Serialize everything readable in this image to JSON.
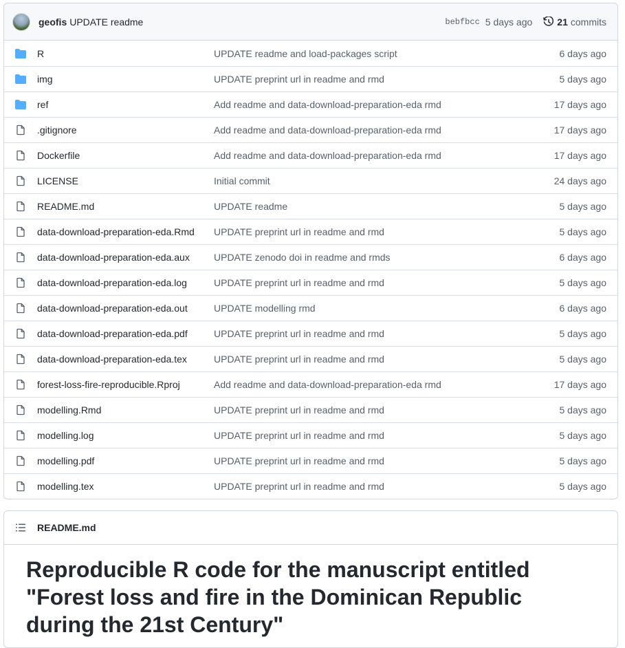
{
  "commit": {
    "author": "geofis",
    "message": "UPDATE readme",
    "sha": "bebfbcc",
    "time": "5 days ago",
    "commit_count": "21",
    "commit_word": "commits"
  },
  "files": [
    {
      "type": "dir",
      "name": "R",
      "message": "UPDATE readme and load-packages script",
      "age": "6 days ago"
    },
    {
      "type": "dir",
      "name": "img",
      "message": "UPDATE preprint url in readme and rmd",
      "age": "5 days ago"
    },
    {
      "type": "dir",
      "name": "ref",
      "message": "Add readme and data-download-preparation-eda rmd",
      "age": "17 days ago"
    },
    {
      "type": "file",
      "name": ".gitignore",
      "message": "Add readme and data-download-preparation-eda rmd",
      "age": "17 days ago"
    },
    {
      "type": "file",
      "name": "Dockerfile",
      "message": "Add readme and data-download-preparation-eda rmd",
      "age": "17 days ago"
    },
    {
      "type": "file",
      "name": "LICENSE",
      "message": "Initial commit",
      "age": "24 days ago"
    },
    {
      "type": "file",
      "name": "README.md",
      "message": "UPDATE readme",
      "age": "5 days ago"
    },
    {
      "type": "file",
      "name": "data-download-preparation-eda.Rmd",
      "message": "UPDATE preprint url in readme and rmd",
      "age": "5 days ago"
    },
    {
      "type": "file",
      "name": "data-download-preparation-eda.aux",
      "message": "UPDATE zenodo doi in readme and rmds",
      "age": "6 days ago"
    },
    {
      "type": "file",
      "name": "data-download-preparation-eda.log",
      "message": "UPDATE preprint url in readme and rmd",
      "age": "5 days ago"
    },
    {
      "type": "file",
      "name": "data-download-preparation-eda.out",
      "message": "UPDATE modelling rmd",
      "age": "6 days ago"
    },
    {
      "type": "file",
      "name": "data-download-preparation-eda.pdf",
      "message": "UPDATE preprint url in readme and rmd",
      "age": "5 days ago"
    },
    {
      "type": "file",
      "name": "data-download-preparation-eda.tex",
      "message": "UPDATE preprint url in readme and rmd",
      "age": "5 days ago"
    },
    {
      "type": "file",
      "name": "forest-loss-fire-reproducible.Rproj",
      "message": "Add readme and data-download-preparation-eda rmd",
      "age": "17 days ago"
    },
    {
      "type": "file",
      "name": "modelling.Rmd",
      "message": "UPDATE preprint url in readme and rmd",
      "age": "5 days ago"
    },
    {
      "type": "file",
      "name": "modelling.log",
      "message": "UPDATE preprint url in readme and rmd",
      "age": "5 days ago"
    },
    {
      "type": "file",
      "name": "modelling.pdf",
      "message": "UPDATE preprint url in readme and rmd",
      "age": "5 days ago"
    },
    {
      "type": "file",
      "name": "modelling.tex",
      "message": "UPDATE preprint url in readme and rmd",
      "age": "5 days ago"
    }
  ],
  "readme": {
    "filename": "README.md",
    "title": "Reproducible R code for the manuscript entitled \"Forest loss and fire in the Dominican Republic during the 21st Century\""
  },
  "icons": {
    "directory": "folder-icon",
    "file": "file-icon",
    "history": "history-icon",
    "toc": "list-icon"
  },
  "colors": {
    "folder": "#54aeff",
    "muted_text": "#57606a",
    "border": "#d0d7de",
    "header_bg": "#f6f8fa"
  }
}
